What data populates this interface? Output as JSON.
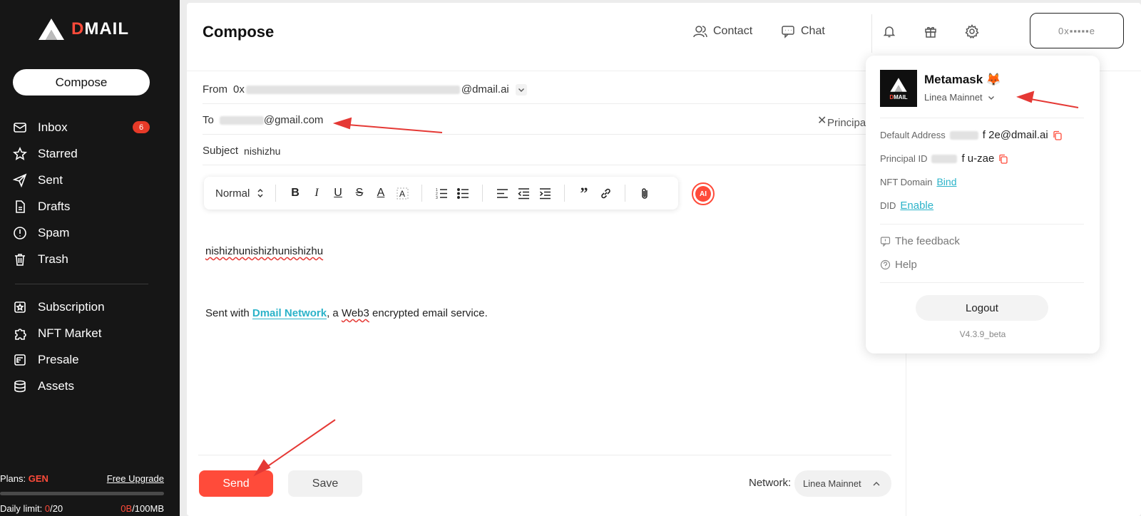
{
  "app": {
    "logo_text_prefix": "D",
    "logo_text": "MAIL"
  },
  "sidebar": {
    "compose_label": "Compose",
    "items": [
      {
        "label": "Inbox",
        "icon": "inbox-icon",
        "badge": "6"
      },
      {
        "label": "Starred",
        "icon": "star-icon"
      },
      {
        "label": "Sent",
        "icon": "send-icon"
      },
      {
        "label": "Drafts",
        "icon": "draft-icon"
      },
      {
        "label": "Spam",
        "icon": "spam-icon"
      },
      {
        "label": "Trash",
        "icon": "trash-icon"
      }
    ],
    "secondary": [
      {
        "label": "Subscription",
        "icon": "subscription-icon"
      },
      {
        "label": "NFT Market",
        "icon": "puzzle-icon"
      },
      {
        "label": "Presale",
        "icon": "presale-icon"
      },
      {
        "label": "Assets",
        "icon": "database-icon"
      }
    ],
    "plans_label": "Plans: ",
    "plans_value": "GEN",
    "upgrade_label": "Free Upgrade",
    "daily_label": "Daily limit: ",
    "daily_used": "0",
    "daily_total": "/20",
    "storage_used": "0B",
    "storage_total": "/100MB",
    "storage_fraction": 0.0
  },
  "header": {
    "title": "Compose",
    "contact_label": "Contact",
    "chat_label": "Chat",
    "wallet_label": "0x▪▪▪▪▪e"
  },
  "compose": {
    "from_label": "From",
    "from_prefix": "0x",
    "from_suffix": "@dmail.ai",
    "to_label": "To",
    "to_suffix": "@gmail.com",
    "principal_label": "Principa",
    "subject_label": "Subject",
    "subject_value": "nishizhu",
    "format_label": "Normal",
    "body": "nishizhunishizhunishizhu",
    "sig_prefix": "Sent with ",
    "sig_link": "Dmail Network",
    "sig_mid": ", a ",
    "sig_web3": "Web3",
    "sig_suffix": " encrypted email service.",
    "ai_label": "AI"
  },
  "footer": {
    "send_label": "Send",
    "save_label": "Save",
    "network_label": "Network:",
    "network_value": "Linea Mainnet"
  },
  "popup": {
    "wallet_name": "Metamask 🦊",
    "network": "Linea Mainnet",
    "default_address_label": "Default Address",
    "default_address_value": "f  2e@dmail.ai",
    "principal_label": "Principal ID",
    "principal_value": "f   u-zae",
    "nft_label": "NFT Domain",
    "nft_link": "Bind",
    "did_label": "DID",
    "did_link": "Enable",
    "feedback_label": "The feedback",
    "help_label": "Help",
    "logout_label": "Logout",
    "version": "V4.3.9_beta"
  },
  "colors": {
    "accent": "#ff4b3a",
    "link": "#2bb3c9",
    "sidebar_bg": "#161616"
  }
}
